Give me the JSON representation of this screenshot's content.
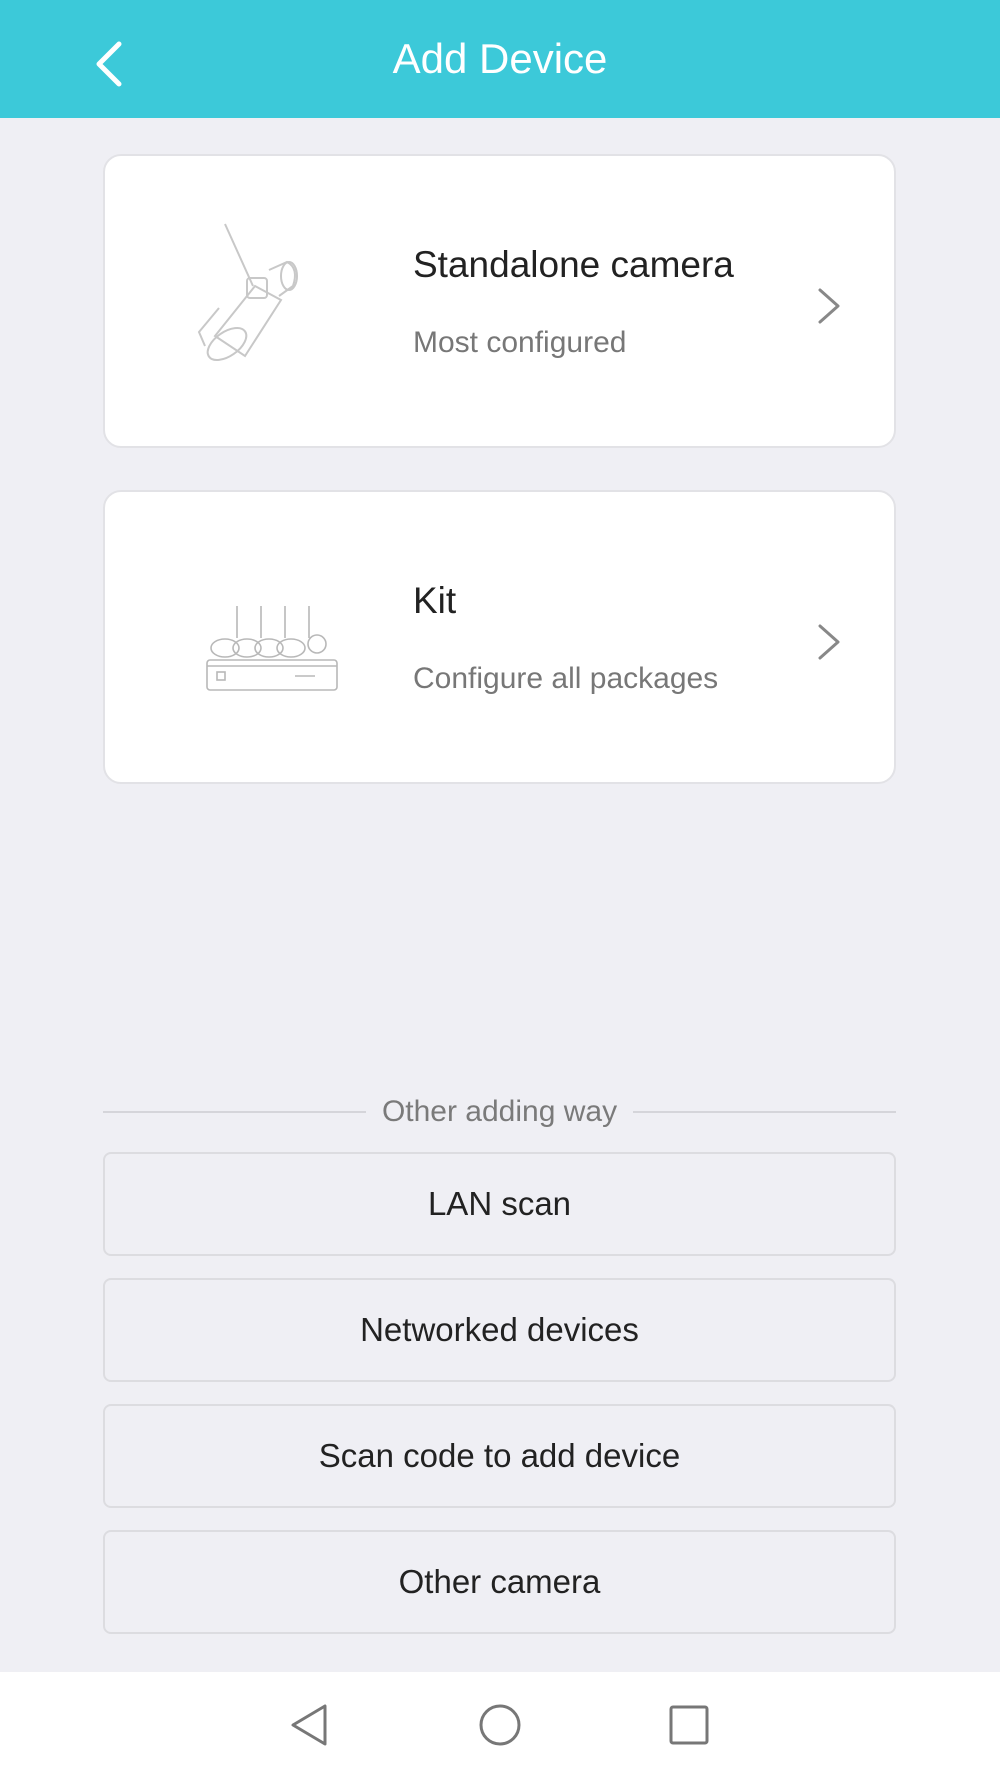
{
  "header": {
    "title": "Add Device",
    "back_icon": "chevron-left-icon",
    "background_color": "#3cc9d9"
  },
  "cards": [
    {
      "title": "Standalone camera",
      "subtitle": "Most configured",
      "icon": "standalone-camera-image"
    },
    {
      "title": "Kit",
      "subtitle": "Configure all packages",
      "icon": "camera-kit-image"
    }
  ],
  "other_section": {
    "heading": "Other adding way",
    "options": [
      "LAN scan",
      "Networked devices",
      "Scan code to add device",
      "Other camera"
    ]
  },
  "nav_bar": {
    "buttons": [
      "back-triangle-icon",
      "home-circle-icon",
      "recents-square-icon"
    ]
  }
}
